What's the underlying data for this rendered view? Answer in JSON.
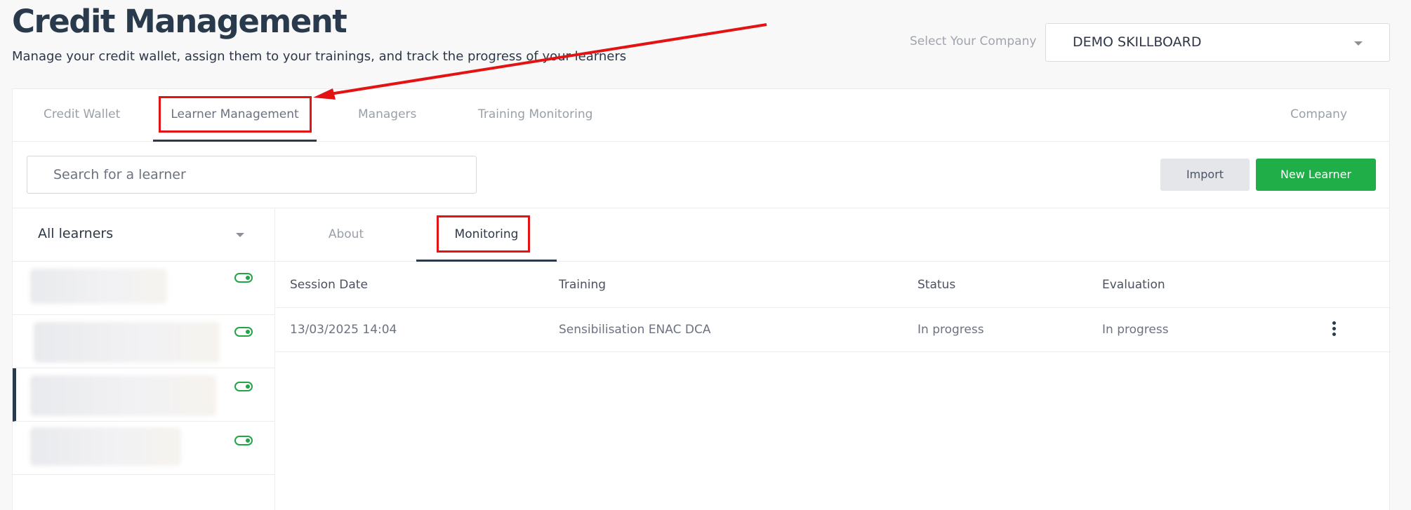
{
  "header": {
    "title": "Credit Management",
    "subtitle": "Manage your credit wallet, assign them to your trainings, and track the progress of your learners"
  },
  "company": {
    "label": "Select Your Company",
    "selected": "DEMO SKILLBOARD"
  },
  "tabs": [
    {
      "label": "Credit Wallet",
      "active": false
    },
    {
      "label": "Learner Management",
      "active": true
    },
    {
      "label": "Managers",
      "active": false
    },
    {
      "label": "Training Monitoring",
      "active": false
    },
    {
      "label": "Company",
      "active": false
    }
  ],
  "search": {
    "placeholder": "Search for a learner"
  },
  "actions": {
    "import_label": "Import",
    "new_label": "New Learner"
  },
  "filter": {
    "selected": "All learners"
  },
  "learners": [
    {
      "name": "",
      "active": true,
      "selected": false
    },
    {
      "name": "",
      "active": true,
      "selected": false
    },
    {
      "name": "",
      "active": true,
      "selected": true
    },
    {
      "name": "",
      "active": true,
      "selected": false
    }
  ],
  "detail_tabs": [
    {
      "label": "About",
      "active": false
    },
    {
      "label": "Monitoring",
      "active": true
    }
  ],
  "table": {
    "headers": [
      "Session Date",
      "Training",
      "Status",
      "Evaluation"
    ],
    "rows": [
      [
        "13/03/2025 14:04",
        "Sensibilisation ENAC DCA",
        "In progress",
        "In progress"
      ]
    ]
  },
  "colors": {
    "accent_dark": "#2a3a4d",
    "primary_green": "#1fae48",
    "annotation_red": "#e31313"
  },
  "icons": [
    "chevron-down-icon",
    "toggle-on-icon",
    "kebab-menu-icon"
  ]
}
